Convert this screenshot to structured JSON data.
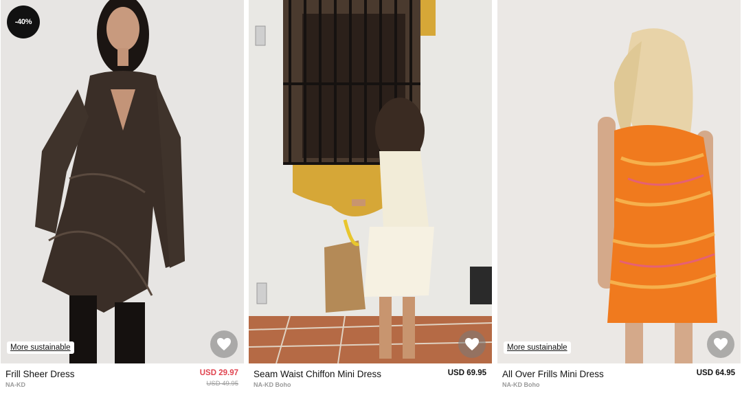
{
  "products": [
    {
      "name": "Frill Sheer Dress",
      "brand": "NA-KD",
      "price": "USD 29.97",
      "old_price": "USD 49.95",
      "badge": "-40%",
      "tag": "More sustainable",
      "sale_color": "#e0434f"
    },
    {
      "name": "Seam Waist Chiffon Mini Dress",
      "brand": "NA-KD Boho",
      "price": "USD 69.95"
    },
    {
      "name": "All Over Frills Mini Dress",
      "brand": "NA-KD Boho",
      "price": "USD 64.95",
      "tag": "More sustainable"
    }
  ],
  "icons": {
    "favorite": "heart-icon"
  }
}
